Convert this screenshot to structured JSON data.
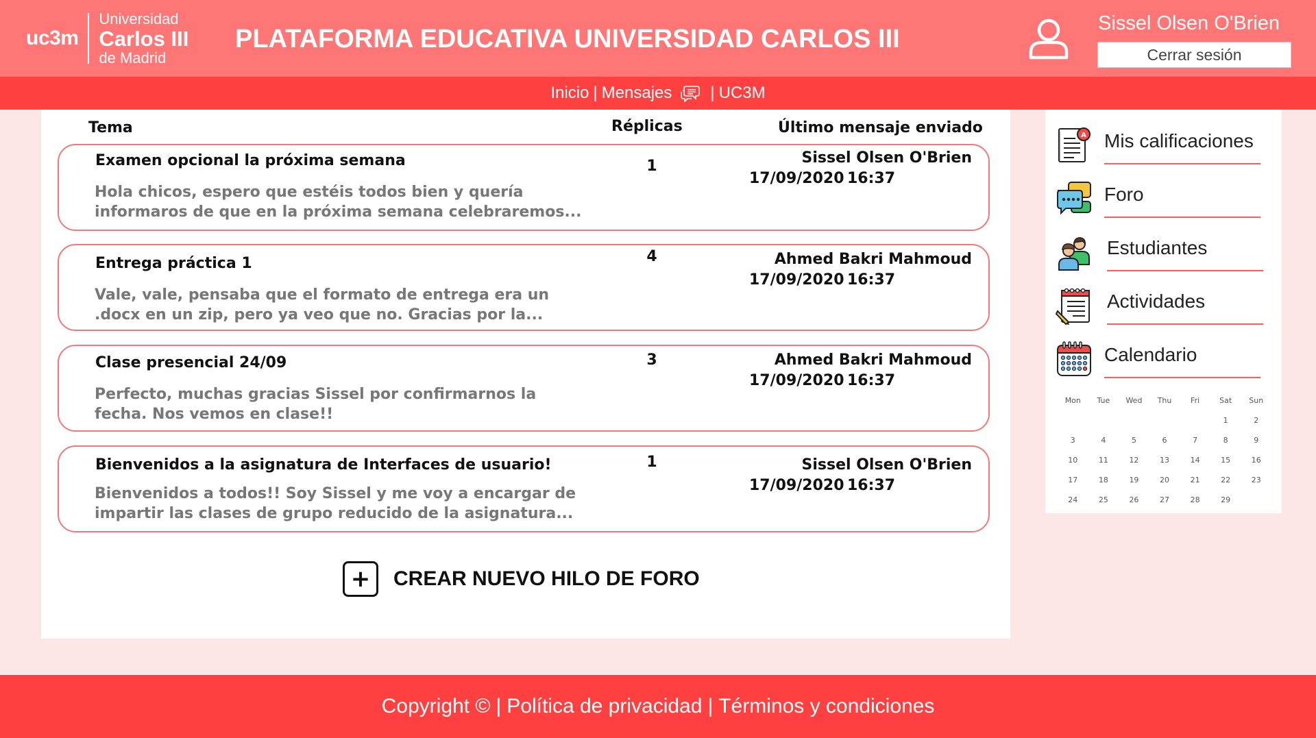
{
  "header": {
    "logo": {
      "short": "uc3m",
      "line1": "Universidad",
      "line2": "Carlos III",
      "line3": "de Madrid"
    },
    "title": "PLATAFORMA EDUCATIVA UNIVERSIDAD CARLOS III",
    "user_name": "Sissel Olsen O'Brien",
    "logout_label": "Cerrar sesión"
  },
  "nav": {
    "home": "Inicio",
    "separator": "|",
    "messages": "Mensajes",
    "uc3m": "UC3M"
  },
  "forum": {
    "columns": {
      "topic": "Tema",
      "replies": "Réplicas",
      "last_message": "Último mensaje enviado"
    },
    "threads": [
      {
        "title": "Examen opcional la próxima semana",
        "preview": "Hola chicos, espero que estéis todos bien y quería informaros de que en la próxima semana celebraremos...",
        "replies": "1",
        "author": "Sissel Olsen O'Brien",
        "date": "17/09/2020",
        "time": "16:37"
      },
      {
        "title": "Entrega práctica 1",
        "preview": "Vale, vale, pensaba que el formato de entrega era un .docx en un zip, pero ya veo que no. Gracias por la...",
        "replies": "4",
        "author": "Ahmed Bakri Mahmoud",
        "date": "17/09/2020",
        "time": "16:37"
      },
      {
        "title": "Clase presencial 24/09",
        "preview": "Perfecto, muchas gracias Sissel por confirmarnos la fecha. Nos vemos en clase!!",
        "replies": "3",
        "author": "Ahmed Bakri Mahmoud",
        "date": "17/09/2020",
        "time": "16:37"
      },
      {
        "title": "Bienvenidos a la asignatura de Interfaces de usuario!",
        "preview": "Bienvenidos a todos!! Soy Sissel y me voy a encargar de impartir las clases de grupo reducido de la asignatura...",
        "replies": "1",
        "author": "Sissel Olsen O'Brien",
        "date": "17/09/2020",
        "time": "16:37"
      }
    ],
    "create_label": "CREAR NUEVO HILO DE FORO",
    "create_icon": "plus-square-icon"
  },
  "sidebar": {
    "items": [
      {
        "label": "Mis calificaciones",
        "icon": "grades-document-icon"
      },
      {
        "label": "Foro",
        "icon": "forum-chat-icon"
      },
      {
        "label": "Estudiantes",
        "icon": "students-icon"
      },
      {
        "label": "Actividades",
        "icon": "activities-notepad-icon"
      },
      {
        "label": "Calendario",
        "icon": "calendar-icon"
      }
    ],
    "calendar": {
      "weekdays": [
        "Mon",
        "Tue",
        "Wed",
        "Thu",
        "Fri",
        "Sat",
        "Sun"
      ],
      "weeks": [
        [
          "",
          "",
          "",
          "",
          "",
          "1",
          "2"
        ],
        [
          "3",
          "4",
          "5",
          "6",
          "7",
          "8",
          "9"
        ],
        [
          "10",
          "11",
          "12",
          "13",
          "14",
          "15",
          "16"
        ],
        [
          "17",
          "18",
          "19",
          "20",
          "21",
          "22",
          "23"
        ],
        [
          "24",
          "25",
          "26",
          "27",
          "28",
          "29",
          ""
        ]
      ]
    }
  },
  "footer": {
    "copyright": "Copyright ©",
    "privacy": "Política de privacidad",
    "terms": "Términos y condiciones",
    "separator": "|"
  },
  "colors": {
    "header_bg": "#fe7675",
    "nav_bg": "#fe4040",
    "footer_bg": "#fe4040",
    "page_bg": "#fde6e6",
    "thread_border": "#f07a7a"
  }
}
